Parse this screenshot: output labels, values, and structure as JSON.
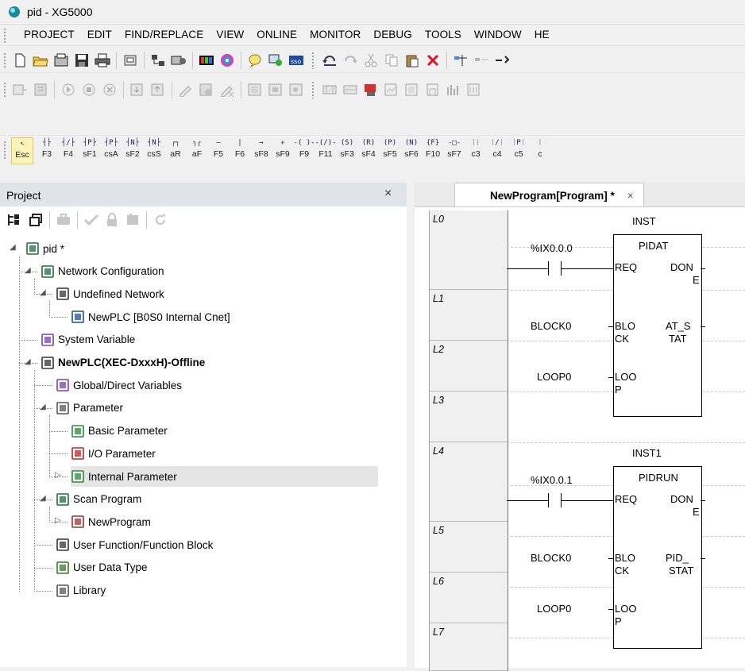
{
  "window": {
    "title": "pid - XG5000"
  },
  "menu": [
    "PROJECT",
    "EDIT",
    "FIND/REPLACE",
    "VIEW",
    "ONLINE",
    "MONITOR",
    "DEBUG",
    "TOOLS",
    "WINDOW",
    "HE"
  ],
  "fkeys": [
    {
      "sym": "↖",
      "key": "Esc"
    },
    {
      "sym": "┤├",
      "key": "F3"
    },
    {
      "sym": "┤/├",
      "key": "F4"
    },
    {
      "sym": "┤P├",
      "key": "sF1"
    },
    {
      "sym": "┤P├",
      "key": "csA"
    },
    {
      "sym": "┤N├",
      "key": "sF2"
    },
    {
      "sym": "┤N├",
      "key": "csS"
    },
    {
      "sym": "┌┐",
      "key": "aR"
    },
    {
      "sym": "┐┌",
      "key": "aF"
    },
    {
      "sym": "—",
      "key": "F5"
    },
    {
      "sym": "|",
      "key": "F6"
    },
    {
      "sym": "→",
      "key": "sF8"
    },
    {
      "sym": "✳",
      "key": "sF9"
    },
    {
      "sym": "-( )-",
      "key": "F9"
    },
    {
      "sym": "-(/)-",
      "key": "F11"
    },
    {
      "sym": "(S)",
      "key": "sF3"
    },
    {
      "sym": "(R)",
      "key": "sF4"
    },
    {
      "sym": "(P)",
      "key": "sF5"
    },
    {
      "sym": "(N)",
      "key": "sF6"
    },
    {
      "sym": "{F}",
      "key": "F10"
    },
    {
      "sym": "-□-",
      "key": "sF7"
    },
    {
      "sym": "ᛁᛁ",
      "key": "c3"
    },
    {
      "sym": "ᛁ/ᛁ",
      "key": "c4"
    },
    {
      "sym": "ᛁPᛁ",
      "key": "c5"
    },
    {
      "sym": "ᛁ",
      "key": "c"
    }
  ],
  "project_panel": {
    "title": "Project",
    "close": "×",
    "tree": [
      {
        "label": "pid *",
        "icon": "project-icon",
        "bold": false
      },
      {
        "label": "Network Configuration",
        "icon": "network-config-icon",
        "bold": false
      },
      {
        "label": "Undefined Network",
        "icon": "network-icon",
        "bold": false
      },
      {
        "label": "NewPLC [B0S0 Internal Cnet]",
        "icon": "plc-icon",
        "bold": false
      },
      {
        "label": "System Variable",
        "icon": "system-variable-icon",
        "bold": false
      },
      {
        "label": "NewPLC(XEC-DxxxH)-Offline",
        "icon": "plc-folder-icon",
        "bold": true
      },
      {
        "label": "Global/Direct Variables",
        "icon": "global-variable-icon",
        "bold": false
      },
      {
        "label": "Parameter",
        "icon": "parameter-icon",
        "bold": false
      },
      {
        "label": "Basic Parameter",
        "icon": "basic-parameter-icon",
        "bold": false
      },
      {
        "label": "I/O Parameter",
        "icon": "io-parameter-icon",
        "bold": false
      },
      {
        "label": "Internal Parameter",
        "icon": "internal-parameter-icon",
        "bold": false
      },
      {
        "label": "Scan Program",
        "icon": "scan-program-icon",
        "bold": false
      },
      {
        "label": "NewProgram",
        "icon": "program-icon",
        "bold": false
      },
      {
        "label": "User Function/Function Block",
        "icon": "user-function-icon",
        "bold": false
      },
      {
        "label": "User Data Type",
        "icon": "user-data-type-icon",
        "bold": false
      },
      {
        "label": "Library",
        "icon": "library-icon",
        "bold": false
      }
    ]
  },
  "editor": {
    "tab_label": "NewProgram[Program] *",
    "tab_close": "×",
    "lines": [
      "L0",
      "L1",
      "L2",
      "L3",
      "L4",
      "L5",
      "L6",
      "L7"
    ],
    "blocks": [
      {
        "instance": "INST",
        "fb": "PIDAT",
        "contact": "%IX0.0.0",
        "req": "REQ",
        "done1": "DON",
        "done2": "E",
        "in2": "BLOCK0",
        "pin2a": "BLO",
        "pin2b": "CK",
        "out2a": "AT_S",
        "out2b": "TAT",
        "in3": "LOOP0",
        "pin3a": "LOO",
        "pin3b": "P"
      },
      {
        "instance": "INST1",
        "fb": "PIDRUN",
        "contact": "%IX0.0.1",
        "req": "REQ",
        "done1": "DON",
        "done2": "E",
        "in2": "BLOCK0",
        "pin2a": "BLO",
        "pin2b": "CK",
        "out2a": "PID_",
        "out2b": "STAT",
        "in3": "LOOP0",
        "pin3a": "LOO",
        "pin3b": "P"
      }
    ]
  }
}
